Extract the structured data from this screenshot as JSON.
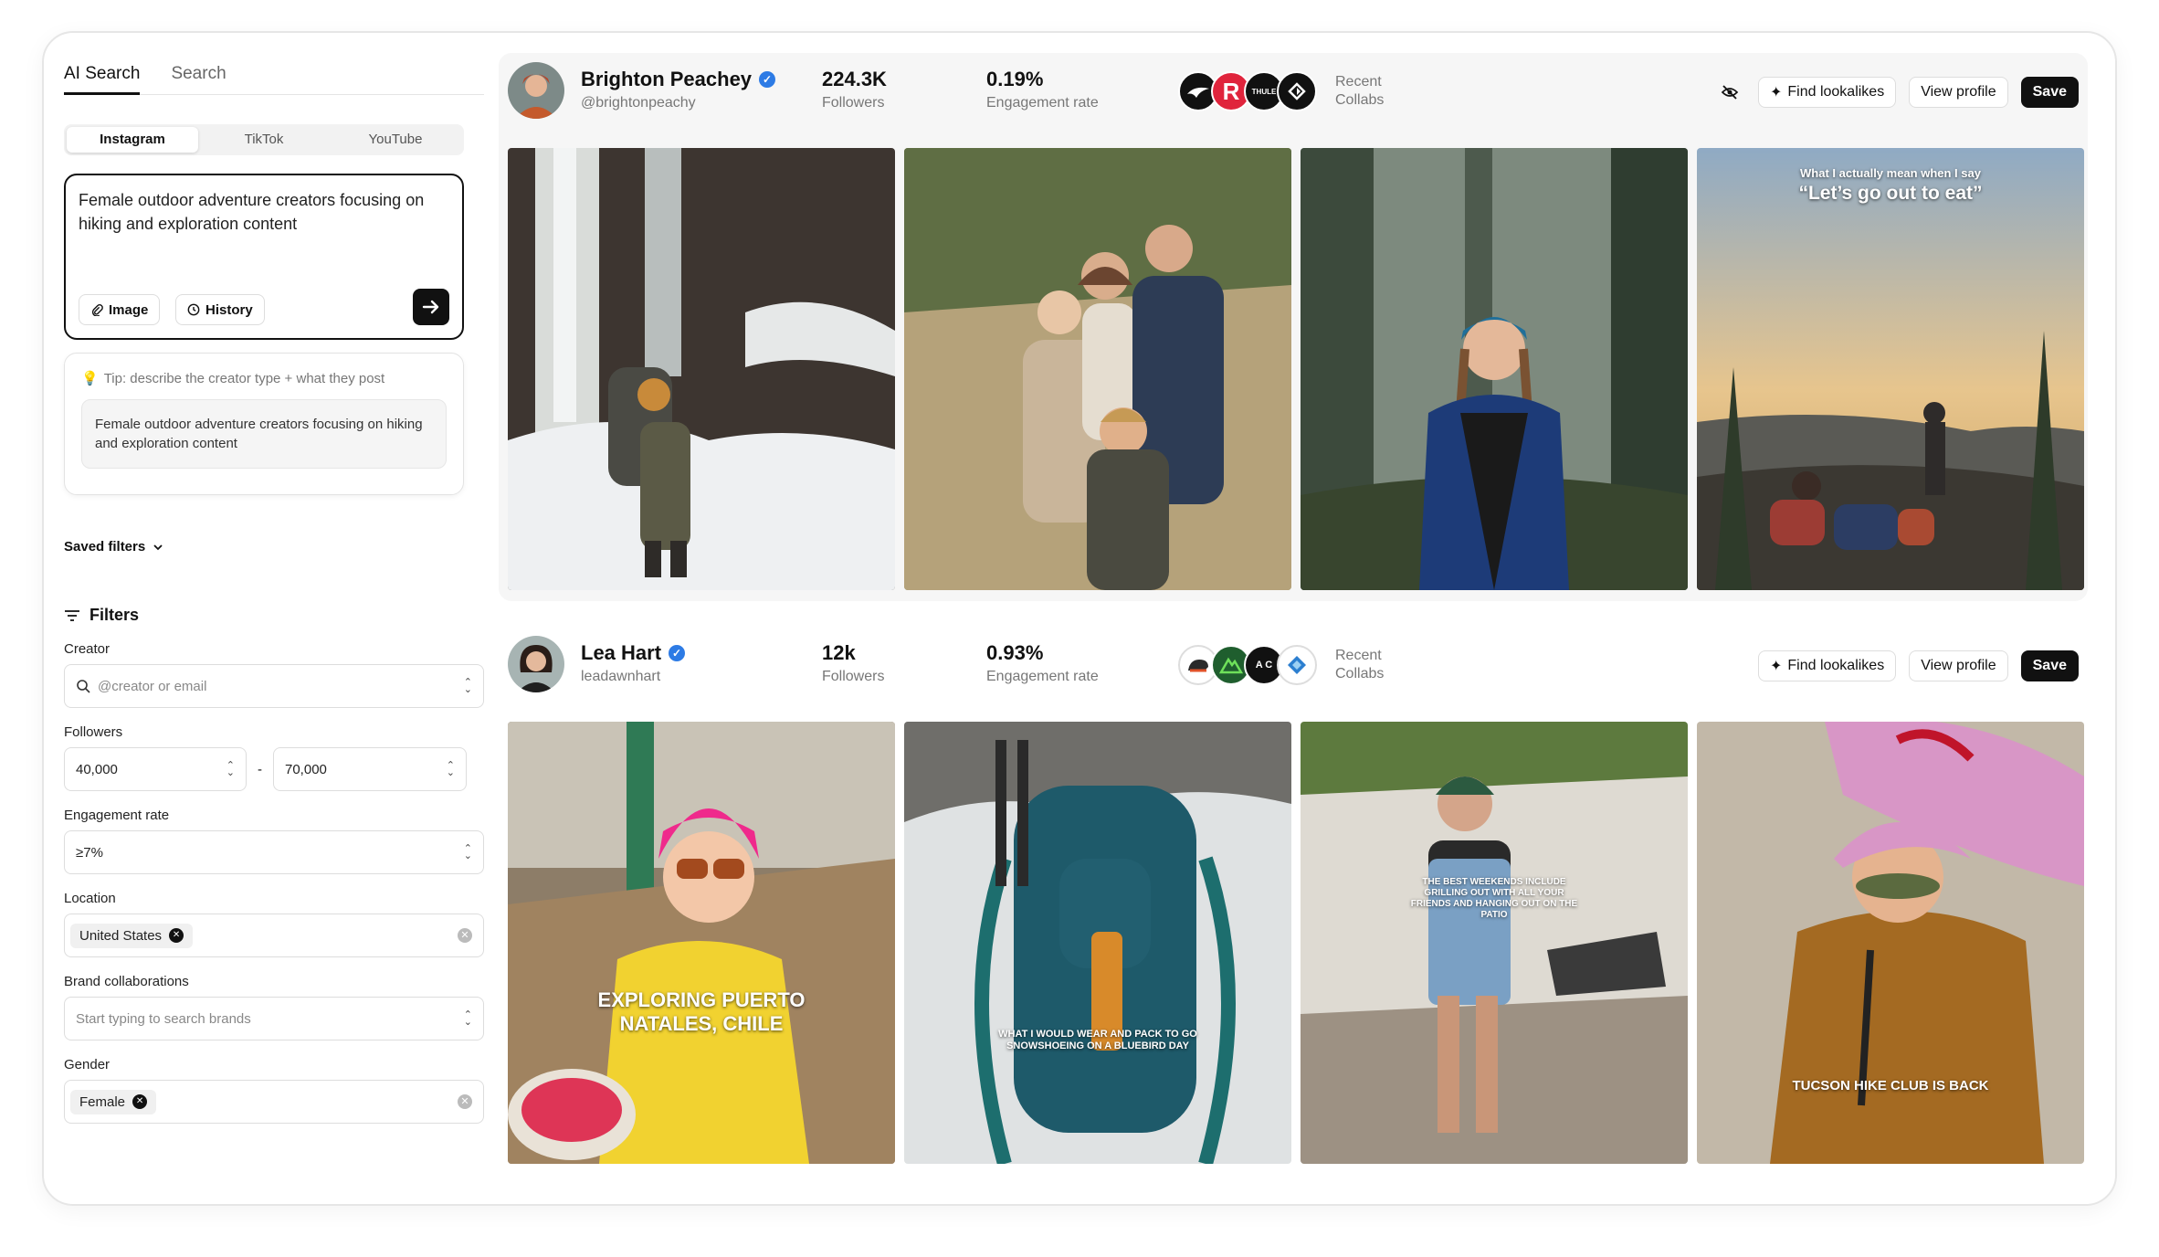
{
  "sidebar": {
    "tabs": [
      "AI Search",
      "Search"
    ],
    "platforms": [
      "Instagram",
      "TikTok",
      "YouTube"
    ],
    "query": "Female outdoor adventure creators focusing on hiking and exploration content",
    "image_label": "Image",
    "history_label": "History",
    "tip": "Tip: describe the creator type + what they post",
    "tip_sample": "Female outdoor adventure creators focusing on hiking and exploration content",
    "saved_filters": "Saved filters",
    "filters_title": "Filters",
    "creator_label": "Creator",
    "creator_placeholder": "@creator or email",
    "followers_label": "Followers",
    "followers_min": "40,000",
    "followers_sep": "-",
    "followers_max": "70,000",
    "engagement_label": "Engagement rate",
    "engagement_value": "≥7%",
    "location_label": "Location",
    "location_chip": "United States",
    "brand_label": "Brand collaborations",
    "brand_placeholder": "Start typing to search brands",
    "gender_label": "Gender",
    "gender_chip": "Female"
  },
  "creators": [
    {
      "name": "Brighton Peachey",
      "handle": "@brightonpeachy",
      "followers": "224.3K",
      "followers_label": "Followers",
      "engagement": "0.19%",
      "engagement_label": "Engagement rate",
      "recent_collabs": [
        "Recent",
        "Collabs"
      ],
      "logo_texts": [
        "",
        "R",
        "THULE",
        ""
      ],
      "find_lookalikes": "Find lookalikes",
      "view_profile": "View profile",
      "save": "Save",
      "overlays": [
        "",
        "",
        "",
        "What I actually mean when I say",
        "“Let’s go out to eat”"
      ]
    },
    {
      "name": "Lea Hart",
      "handle": "leadawnhart",
      "followers": "12k",
      "followers_label": "Followers",
      "engagement": "0.93%",
      "engagement_label": "Engagement rate",
      "recent_collabs": [
        "Recent",
        "Collabs"
      ],
      "logo_texts": [
        "",
        "",
        "A C",
        ""
      ],
      "find_lookalikes": "Find lookalikes",
      "view_profile": "View profile",
      "save": "Save",
      "overlays": [
        "EXPLORING PUERTO NATALES, CHILE",
        "WHAT I WOULD WEAR AND PACK TO GO SNOWSHOEING ON A BLUEBIRD DAY",
        "THE BEST WEEKENDS INCLUDE GRILLING OUT WITH ALL YOUR FRIENDS AND HANGING OUT ON THE PATIO",
        "TUCSON HIKE CLUB IS BACK"
      ]
    }
  ]
}
